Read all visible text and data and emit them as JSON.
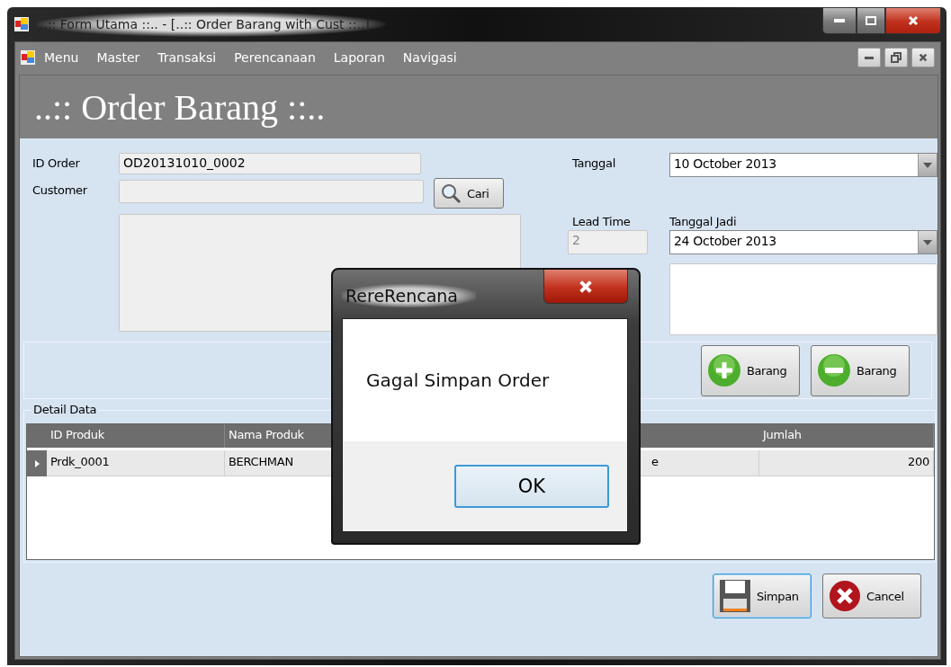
{
  "window": {
    "title": "..:: Form Utama ::.. - [..:: Order Barang with Cust ::..]"
  },
  "menu": [
    "Menu",
    "Master",
    "Transaksi",
    "Perencanaan",
    "Laporan",
    "Navigasi"
  ],
  "form_title": "..:: Order Barang ::..",
  "fields": {
    "id_order": {
      "label": "ID Order",
      "value": "OD20131010_0002"
    },
    "customer": {
      "label": "Customer",
      "button": "Cari"
    },
    "tanggal": {
      "label": "Tanggal",
      "value": "10 October 2013"
    },
    "lead_time": {
      "label": "Lead Time",
      "value": "2",
      "disabled": true
    },
    "tanggal_jadi": {
      "label": "Tanggal Jadi",
      "value": "24 October 2013"
    }
  },
  "item_buttons": [
    {
      "kind": "add",
      "label": "Barang"
    },
    {
      "kind": "remove",
      "label": "Barang"
    }
  ],
  "detail": {
    "title": "Detail Data",
    "columns": [
      "ID Produk",
      "Nama Produk",
      "Jumlah"
    ],
    "rows": [
      {
        "selected": true,
        "cells": [
          "Prdk_0001",
          "BERCHMAN",
          "e",
          "200"
        ]
      }
    ]
  },
  "actions": [
    {
      "kind": "save",
      "label": "Simpan",
      "focused": true
    },
    {
      "kind": "cancel",
      "label": "Cancel",
      "focused": false
    }
  ],
  "dialog": {
    "title": "RereRencana",
    "message": "Gagal Simpan Order",
    "button": "OK"
  }
}
